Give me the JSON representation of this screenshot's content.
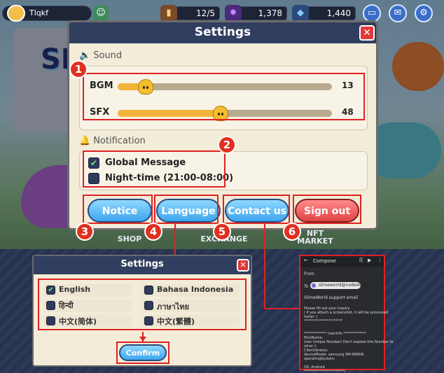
{
  "topbar": {
    "player_name": "Tlqkf",
    "resources": [
      {
        "icon": "ticket-icon",
        "value": "12/5"
      },
      {
        "icon": "gem-icon",
        "value": "1,378"
      },
      {
        "icon": "crystal-icon",
        "value": "1,440"
      }
    ],
    "buttons": [
      "chat-icon",
      "mail-icon",
      "gear-icon"
    ]
  },
  "settings": {
    "title": "Settings",
    "sound_label": "Sound",
    "bgm_label": "BGM",
    "bgm_value": 13,
    "sfx_label": "SFX",
    "sfx_value": 48,
    "notification_label": "Notification",
    "global_message": {
      "label": "Global Message",
      "checked": true
    },
    "night_time": {
      "label": "Night-time (21:00-08:00)",
      "checked": false
    },
    "buttons": {
      "notice": "Notice",
      "language": "Language",
      "contact": "Contact us",
      "signout": "Sign out"
    }
  },
  "badges": [
    "1",
    "2",
    "3",
    "4",
    "5",
    "6"
  ],
  "nav": {
    "shop": "SHOP",
    "exchange": "EXCHANGE",
    "nft": "NFT\nMARKET"
  },
  "language_dialog": {
    "title": "Settings",
    "languages": [
      {
        "label": "English",
        "checked": true
      },
      {
        "label": "Bahasa Indonesia",
        "checked": false
      },
      {
        "label": "हिन्दी",
        "checked": false
      },
      {
        "label": "ภาษาไทย",
        "checked": false
      },
      {
        "label": "中文(简体)",
        "checked": false
      },
      {
        "label": "中文(繁體)",
        "checked": false
      }
    ],
    "confirm": "Confirm"
  },
  "email": {
    "header": "Compose",
    "from_label": "From",
    "to_label": "To",
    "to_value": "slimeworld@nodedigital.co.kr",
    "subject": "SlimeWorld support email",
    "body": "Please fill out your inquiry.\n( If you attach a screenshot, it will be processed\nfaster. )\n**********************\n\n\n************* UserInfo *************\nNickName:\nUser Unique Number( Don't expose this Number to\nother ):\nClientVersion:\ndeviceModel: samsung SM-N986N\noperatingSystem:\n\nOS: Android\n***********************|"
  },
  "colors": {
    "accent_red": "#e02222",
    "header_navy": "#303e5f",
    "panel_cream": "#f2ecd8",
    "slider_orange": "#f2b43a"
  }
}
